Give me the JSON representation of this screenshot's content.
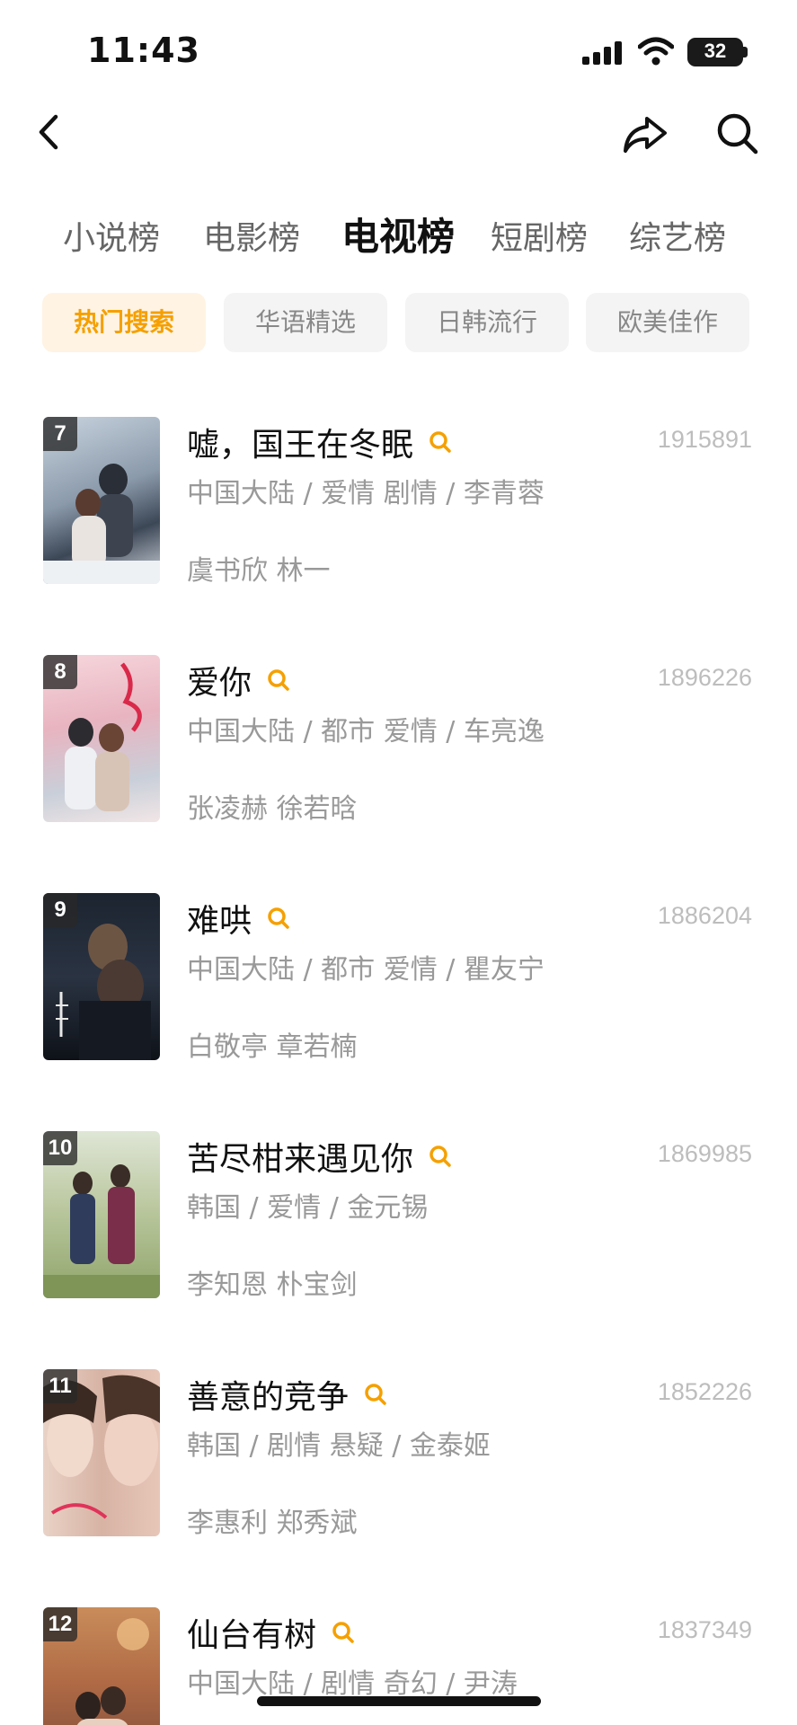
{
  "status_bar": {
    "time": "11:43",
    "battery": "32"
  },
  "nav": {
    "back_icon": "chevron-left-icon",
    "share_icon": "share-arrow-icon",
    "search_icon": "search-icon"
  },
  "tabs": [
    {
      "label": "小说榜",
      "active": false
    },
    {
      "label": "电影榜",
      "active": false
    },
    {
      "label": "电视榜",
      "active": true
    },
    {
      "label": "短剧榜",
      "active": false
    },
    {
      "label": "综艺榜",
      "active": false
    }
  ],
  "chips": [
    {
      "label": "热门搜索",
      "active": true
    },
    {
      "label": "华语精选",
      "active": false
    },
    {
      "label": "日韩流行",
      "active": false
    },
    {
      "label": "欧美佳作",
      "active": false
    }
  ],
  "colors": {
    "accent": "#f5a000",
    "chip_active_bg": "#fff3e3",
    "muted_text": "#999999"
  },
  "items": [
    {
      "rank": "7",
      "title": "嘘，国王在冬眠",
      "heat": "1915891",
      "meta": "中国大陆 / 爱情 剧情 / 李青蓉",
      "cast": "虞书欣 林一"
    },
    {
      "rank": "8",
      "title": "爱你",
      "heat": "1896226",
      "meta": "中国大陆 / 都市 爱情 / 车亮逸",
      "cast": "张凌赫 徐若晗"
    },
    {
      "rank": "9",
      "title": "难哄",
      "heat": "1886204",
      "meta": "中国大陆 / 都市 爱情 / 瞿友宁",
      "cast": "白敬亭 章若楠"
    },
    {
      "rank": "10",
      "title": "苦尽柑来遇见你",
      "heat": "1869985",
      "meta": "韩国 / 爱情 / 金元锡",
      "cast": "李知恩 朴宝剑"
    },
    {
      "rank": "11",
      "title": "善意的竞争",
      "heat": "1852226",
      "meta": "韩国 / 剧情 悬疑 / 金泰姬",
      "cast": "李惠利 郑秀斌"
    },
    {
      "rank": "12",
      "title": "仙台有树",
      "heat": "1837349",
      "meta": "中国大陆 / 剧情 奇幻 / 尹涛",
      "cast": ""
    }
  ]
}
